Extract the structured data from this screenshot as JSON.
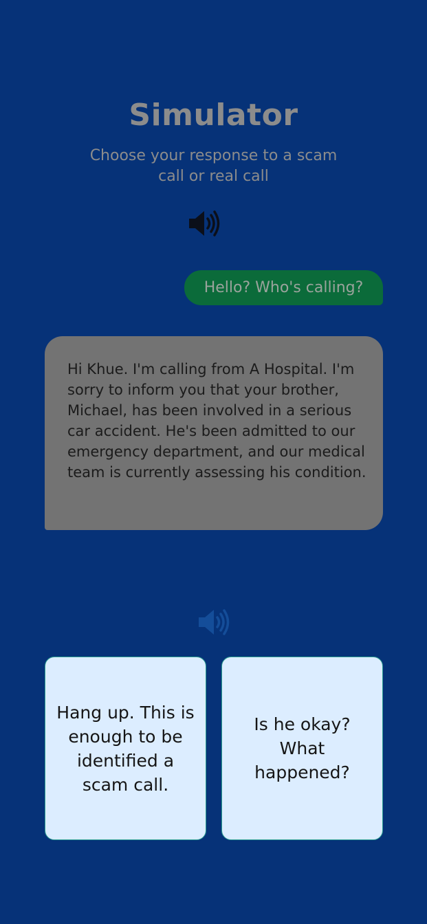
{
  "header": {
    "title": "Simulator",
    "subtitle": "Choose your response to a scam call or real call"
  },
  "icons": {
    "speaker_top": "speaker-volume-icon",
    "speaker_bottom": "speaker-volume-icon"
  },
  "conversation": {
    "user_message": "Hello? Who's calling?",
    "caller_message": "Hi Khue. I'm calling from A Hospital. I'm sorry to inform you that your brother, Michael, has been involved in a serious car accident. He's been admitted to our emergency department, and our medical team is currently assessing his condition."
  },
  "choices": [
    {
      "label": "Hang up. This is enough to be identified a scam call."
    },
    {
      "label": "Is he okay? What happened?"
    }
  ],
  "colors": {
    "background": "#063278",
    "user_bubble": "#0b6b3a",
    "caller_bubble": "#737373",
    "choice_card": "#dcedff",
    "choice_border": "#2a9d8f"
  }
}
